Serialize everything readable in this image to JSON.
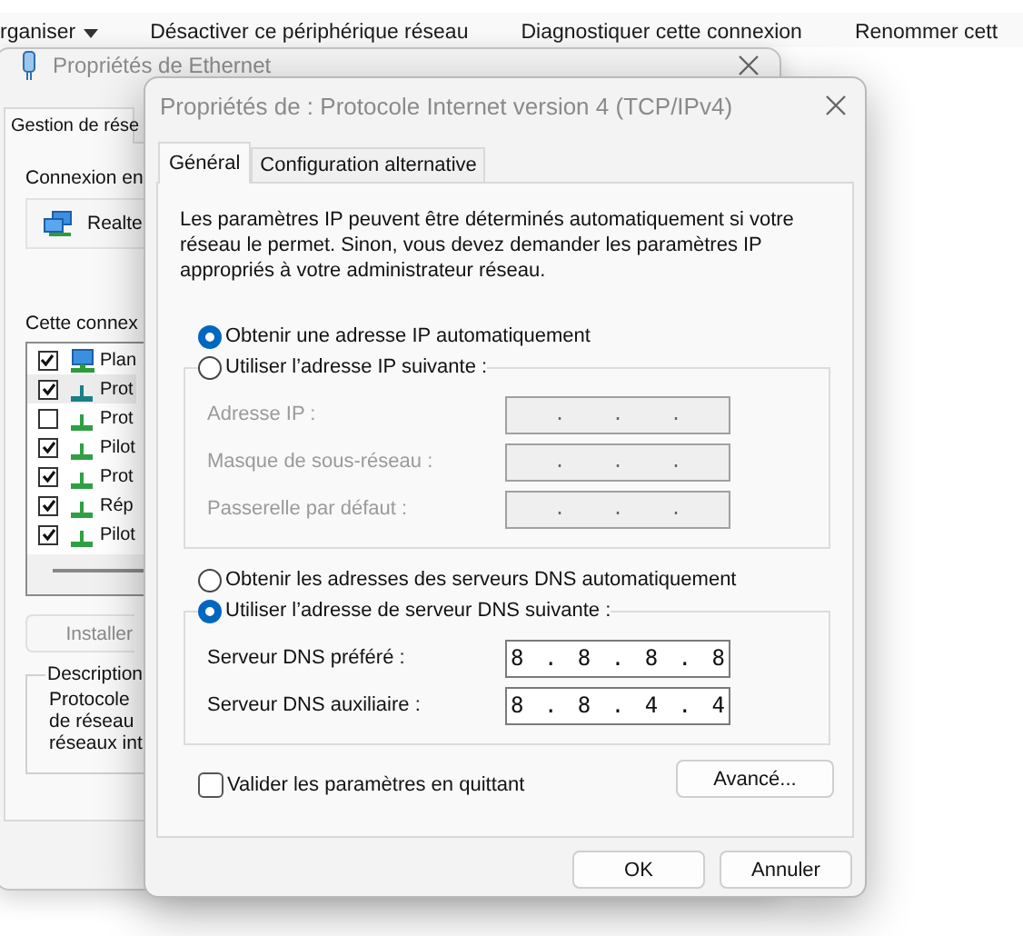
{
  "command_bar": {
    "items": [
      {
        "label": "rganiser",
        "caret": true
      },
      {
        "label": "Désactiver ce périphérique réseau",
        "caret": false
      },
      {
        "label": "Diagnostiquer cette connexion",
        "caret": false
      },
      {
        "label": "Renommer cett",
        "caret": false
      }
    ]
  },
  "ethernet_window": {
    "title": "Propriétés de Ethernet",
    "tab": "Gestion de rése",
    "connect_label": "Connexion en",
    "adapter": "Realte",
    "items_label": "Cette connex",
    "items": [
      {
        "label": "Plan",
        "kind": "client",
        "checked": true,
        "selected": false
      },
      {
        "label": "Prot",
        "kind": "protocol",
        "checked": true,
        "selected": true
      },
      {
        "label": "Prot",
        "kind": "protocol",
        "checked": false,
        "selected": false
      },
      {
        "label": "Pilot",
        "kind": "protocol",
        "checked": true,
        "selected": false
      },
      {
        "label": "Prot",
        "kind": "protocol",
        "checked": true,
        "selected": false
      },
      {
        "label": "Rép",
        "kind": "protocol",
        "checked": true,
        "selected": false
      },
      {
        "label": "Pilot",
        "kind": "protocol",
        "checked": true,
        "selected": false
      }
    ],
    "install_button": "Installer",
    "description_title": "Description",
    "description_lines": [
      "Protocole",
      "de réseau",
      "réseaux int"
    ]
  },
  "dialog": {
    "title": "Propriétés de : Protocole Internet version 4 (TCP/IPv4)",
    "tabs": [
      {
        "label": "Général",
        "selected": true
      },
      {
        "label": "Configuration alternative",
        "selected": false
      }
    ],
    "intro": "Les paramètres IP peuvent être déterminés automatiquement si votre réseau le permet. Sinon, vous devez demander les paramètres IP appropriés à votre administrateur réseau.",
    "ip_options": [
      {
        "label": "Obtenir une adresse IP automatiquement",
        "selected": true
      },
      {
        "label": "Utiliser l’adresse IP suivante :",
        "selected": false
      }
    ],
    "ip_fields": [
      {
        "label": "Adresse IP :",
        "value": ". . .",
        "disabled": true
      },
      {
        "label": "Masque de sous-réseau :",
        "value": ". . .",
        "disabled": true
      },
      {
        "label": "Passerelle par défaut :",
        "value": ". . .",
        "disabled": true
      }
    ],
    "dns_options": [
      {
        "label": "Obtenir les adresses des serveurs DNS automatiquement",
        "selected": false
      },
      {
        "label": "Utiliser l’adresse de serveur DNS suivante :",
        "selected": true
      }
    ],
    "dns_fields": [
      {
        "label": "Serveur DNS préféré :",
        "value": "8 . 8 . 8 . 8",
        "disabled": false
      },
      {
        "label": "Serveur DNS auxiliaire :",
        "value": "8 . 8 . 4 . 4",
        "disabled": false
      }
    ],
    "validate": {
      "label": "Valider les paramètres en quittant",
      "checked": false
    },
    "advanced_button": "Avancé...",
    "buttons": [
      "OK",
      "Annuler"
    ]
  }
}
